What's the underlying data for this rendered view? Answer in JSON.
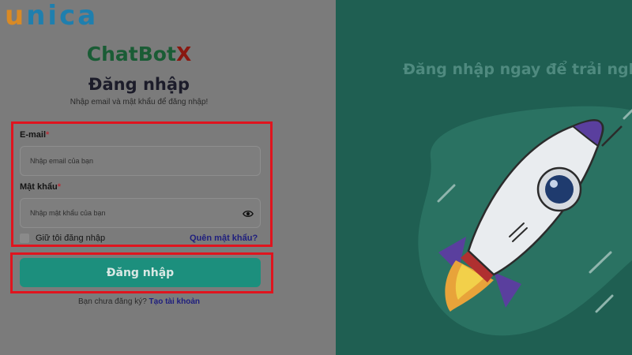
{
  "logo": {
    "u": "u",
    "rest": "nica"
  },
  "brand": {
    "main": "ChatBot",
    "accent": "X"
  },
  "form": {
    "title": "Đăng nhập",
    "subtitle": "Nhập email và mật khẩu để đăng nhập!",
    "email_label": "E-mail",
    "email_placeholder": "Nhập email của bạn",
    "password_label": "Mật khẩu",
    "password_placeholder": "Nhập mật khẩu của bạn",
    "required_mark": "*",
    "remember_label": "Giữ tôi đăng nhập",
    "forgot_label": "Quên mật khẩu?",
    "submit_label": "Đăng nhập",
    "signup_prompt": "Bạn chưa đăng ký?",
    "signup_link": "Tạo tài khoản"
  },
  "hero": {
    "title": "Đăng nhập ngay để trải nghi"
  },
  "colors": {
    "accent": "#1c8f7d",
    "highlight": "#e0141e",
    "panel": "#1f5f52"
  }
}
